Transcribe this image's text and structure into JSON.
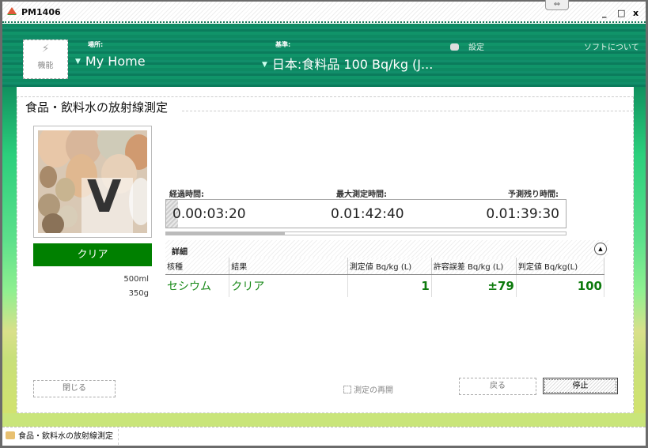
{
  "window": {
    "title": "PM1406",
    "controls": {
      "minimize": "_",
      "maximize": "□",
      "close": "x"
    },
    "resize_handle": "⇔"
  },
  "header": {
    "function_button": {
      "icon": "lightning-icon",
      "label": "機能"
    },
    "location": {
      "label": "場所:",
      "value": "My Home"
    },
    "standard": {
      "label": "基準:",
      "value": "日本:食料品 100 Bq/kg (J..."
    },
    "settings_label": "設定",
    "about_label": "ソフトについて"
  },
  "panel": {
    "title": "食品・飲料水の放射線測定",
    "status": "クリア",
    "status_color": "#008000",
    "volume": "500ml",
    "weight": "350g",
    "times": {
      "elapsed_label": "経過時間:",
      "elapsed": "0.00:03:20",
      "max_label": "最大測定時間:",
      "max": "0.01:42:40",
      "remaining_label": "予測残り時間:",
      "remaining": "0.01:39:30"
    },
    "details": {
      "label": "詳細",
      "columns": [
        "核種",
        "結果",
        "測定値 Bq/kg (L)",
        "許容誤差 Bq/kg (L)",
        "判定値 Bq/kg(L)"
      ],
      "rows": [
        {
          "nuclide": "セシウム",
          "result": "クリア",
          "measured": "1",
          "tolerance": "±79",
          "threshold": "100"
        }
      ]
    },
    "buttons": {
      "close": "閉じる",
      "resume": "測定の再開",
      "back": "戻る",
      "stop": "停止"
    }
  },
  "taskbar": {
    "tab_label": "食品・飲料水の放射線測定"
  }
}
